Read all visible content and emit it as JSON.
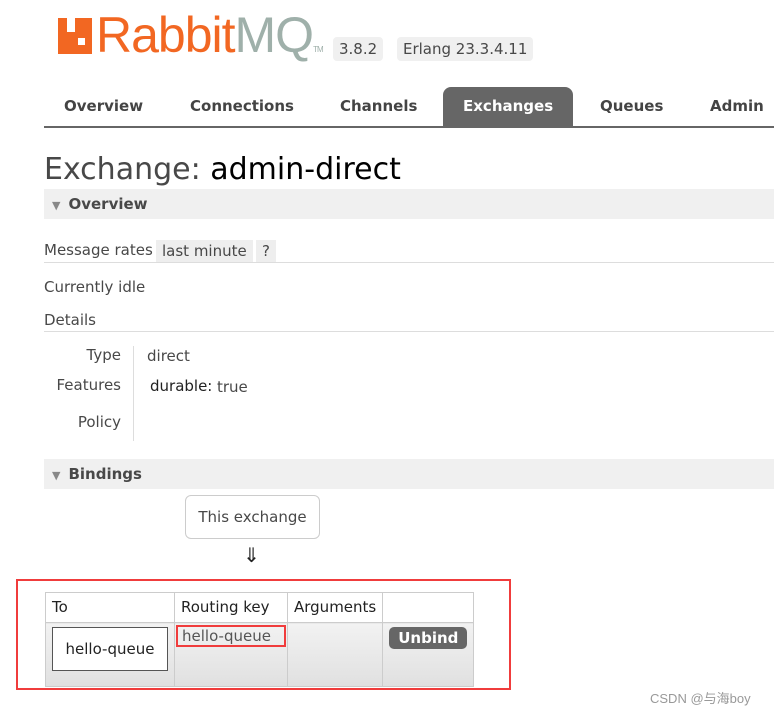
{
  "header": {
    "logo_text_orange": "Rabbit",
    "logo_text_grey": "MQ",
    "logo_tm": "TM",
    "version": "3.8.2",
    "erlang": "Erlang 23.3.4.11"
  },
  "nav": {
    "tabs": [
      "Overview",
      "Connections",
      "Channels",
      "Exchanges",
      "Queues",
      "Admin"
    ],
    "active": "Exchanges"
  },
  "page": {
    "title_prefix": "Exchange:",
    "title_name": "admin-direct"
  },
  "overview": {
    "heading": "Overview",
    "message_rates_label": "Message rates",
    "rate_period": "last minute",
    "help": "?",
    "idle": "Currently idle",
    "details": "Details",
    "type_label": "Type",
    "type_value": "direct",
    "features_label": "Features",
    "feature_key": "durable:",
    "feature_value": "true",
    "policy_label": "Policy"
  },
  "bindings": {
    "heading": "Bindings",
    "this_exchange": "This exchange",
    "arrow": "⇓",
    "columns": [
      "To",
      "Routing key",
      "Arguments",
      ""
    ],
    "rows": [
      {
        "to": "hello-queue",
        "routing_key": "hello-queue",
        "arguments": "",
        "action": "Unbind"
      }
    ]
  },
  "watermark": "CSDN @与海boy",
  "colors": {
    "brand_orange": "#f26722",
    "annotation_red": "#f03c3c",
    "active_tab": "#666666"
  }
}
